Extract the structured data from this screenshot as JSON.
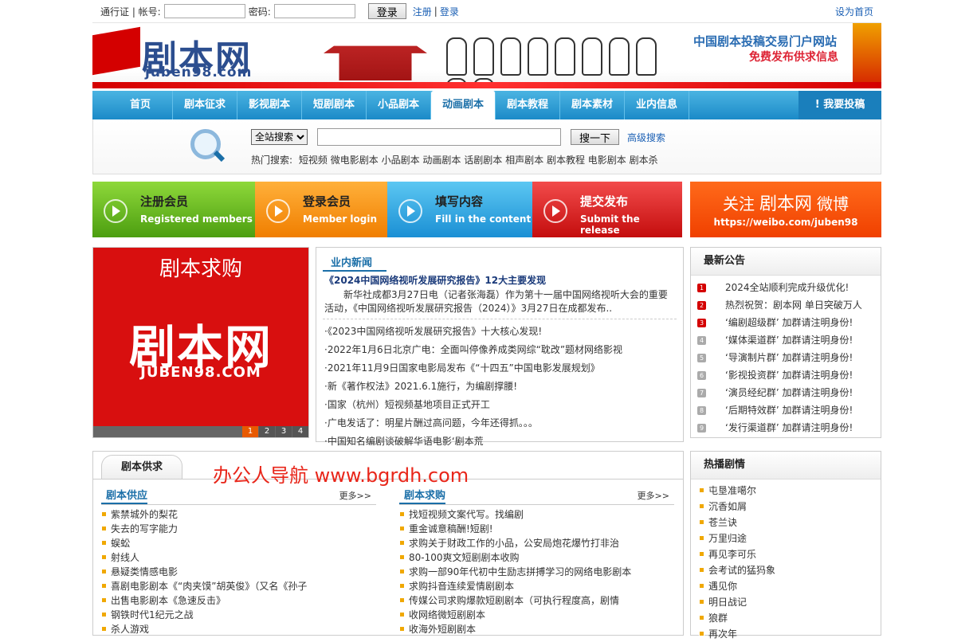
{
  "topbar": {
    "passport_label": "通行证 | 帐号:",
    "password_label": "密码:",
    "login_button": "登录",
    "register_link": "注册",
    "separator": "|",
    "login_link": "登录",
    "set_home": "设为首页"
  },
  "banner": {
    "logo_cn": "剧本网",
    "logo_en": "juben98.com",
    "slogan1": "中国剧本投稿交易门户网站",
    "slogan2": "免费发布供求信息"
  },
  "nav": {
    "items": [
      "首页",
      "剧本征求",
      "影视剧本",
      "短剧剧本",
      "小品剧本",
      "动画剧本",
      "剧本教程",
      "剧本素材",
      "业内信息"
    ],
    "active_index": 5,
    "post_button": "! 我要投稿"
  },
  "search": {
    "scope_selected": "全站搜索",
    "query_value": "",
    "search_button": "搜一下",
    "advanced_link": "高级搜索",
    "hot_label": "热门搜索:",
    "hot_terms": [
      "短视频",
      "微电影剧本",
      "小品剧本",
      "动画剧本",
      "话剧剧本",
      "相声剧本",
      "剧本教程",
      "电影剧本",
      "剧本杀"
    ]
  },
  "steps": [
    {
      "cn": "注册会员",
      "en": "Registered members"
    },
    {
      "cn": "登录会员",
      "en": "Member login"
    },
    {
      "cn": "填写内容",
      "en": "Fill in the content"
    },
    {
      "cn": "提交发布",
      "en": "Submit the release"
    }
  ],
  "weibo": {
    "follow": "关注",
    "name": "剧本网",
    "platform": "微博",
    "url": "https://weibo.com/juben98"
  },
  "slider": {
    "heading": "剧本求购",
    "logo_cn": "剧本网",
    "logo_en": "JUBEN98.COM",
    "pages": [
      "1",
      "2",
      "3",
      "4"
    ],
    "current_page": "1"
  },
  "news": {
    "heading": "业内新闻",
    "headline": "《2024中国网络视听发展研究报告》12大主要发现",
    "summary": "新华社成都3月27日电（记者张海磊）作为第十一届中国网络视听大会的重要活动，《中国网络视听发展研究报告（2024）》3月27日在成都发布..",
    "items": [
      "·《2023中国网络视听发展研究报告》十大核心发现!",
      "·2022年1月6日北京广电：全面叫停像养成类网综“耽改”题材网络影视",
      "·2021年11月9日国家电影局发布《“十四五”中国电影发展规划》",
      "·新《著作权法》2021.6.1施行，为编剧撑腰!",
      "·国家（杭州）短视频基地项目正式开工",
      "·广电发话了：明星片酬过高问题，今年还得抓。。。",
      "·中国知名编剧谈破解华语电影‘剧本荒"
    ]
  },
  "notices": {
    "heading": "最新公告",
    "items": [
      {
        "n": "1",
        "text": "2024全站顺利完成升级优化!"
      },
      {
        "n": "2",
        "text": "热烈祝贺：剧本网 单日突破万人"
      },
      {
        "n": "3",
        "text": "‘编剧超级群’ 加群请注明身份!"
      },
      {
        "n": "4",
        "text": "‘媒体渠道群’ 加群请注明身份!"
      },
      {
        "n": "5",
        "text": "‘导演制片群’ 加群请注明身份!"
      },
      {
        "n": "6",
        "text": "‘影视投资群’ 加群请注明身份!"
      },
      {
        "n": "7",
        "text": "‘演员经纪群’ 加群请注明身份!"
      },
      {
        "n": "8",
        "text": "‘后期特效群’ 加群请注明身份!"
      },
      {
        "n": "9",
        "text": "‘发行渠道群’ 加群请注明身份!"
      }
    ]
  },
  "supply": {
    "tab": "剧本供求",
    "watermark": "办公人导航 www.bgrdh.com",
    "supply_col": {
      "title": "剧本供应",
      "more": "更多>>",
      "items": [
        "紫禁城外的梨花",
        "失去的写字能力",
        "蜈蚣",
        "射线人",
        "悬疑类情感电影",
        "喜剧电影剧本《“肉夹馍”胡英俊》（又名《孙子",
        "出售电影剧本《急速反击》",
        "钢铁时代1纪元之战",
        "杀人游戏"
      ]
    },
    "demand_col": {
      "title": "剧本求购",
      "more": "更多>>",
      "items": [
        "找短视频文案代写。找编剧",
        "重金诚意稿酬!短剧!",
        "求购关于财政工作的小品，公安局炮花爆竹打非治",
        "80-100爽文短剧剧本收购",
        "求购一部90年代初中生励志拼搏学习的网络电影剧本",
        "求购抖音连续爱情剧剧本",
        "传媒公司求购爆款短剧剧本（可执行程度高，剧情",
        "收网络微短剧剧本",
        "收海外短剧剧本"
      ]
    }
  },
  "hot": {
    "heading": "热播剧情",
    "items": [
      "屯垦准噶尔",
      "沉香如屑",
      "苍兰诀",
      "万里归途",
      "再见李可乐",
      "会考试的猛犸象",
      "遇见你",
      "明日战记",
      "狼群",
      "再次年"
    ]
  }
}
